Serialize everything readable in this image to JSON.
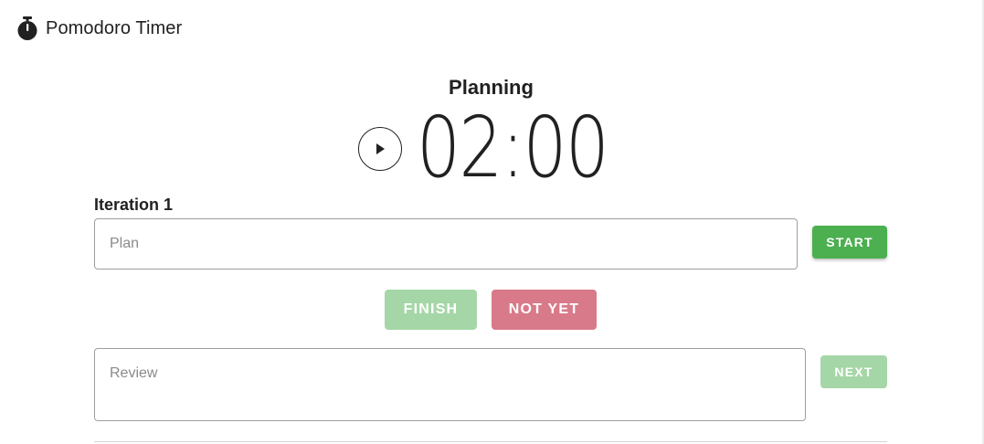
{
  "app": {
    "title": "Pomodoro Timer",
    "icon": "stopwatch-icon"
  },
  "timer": {
    "phase": "Planning",
    "time": "02:00",
    "play_icon": "play-icon"
  },
  "iteration": {
    "label": "Iteration 1",
    "plan_placeholder": "Plan",
    "plan_value": "",
    "start_label": "START",
    "finish_label": "FINISH",
    "not_yet_label": "NOT YET",
    "review_placeholder": "Review",
    "review_value": "",
    "next_label": "NEXT"
  },
  "colors": {
    "start": "#4caf50",
    "finish_disabled": "#a5d6a7",
    "not_yet": "#d87a89",
    "next_disabled": "#a5d6a7"
  }
}
